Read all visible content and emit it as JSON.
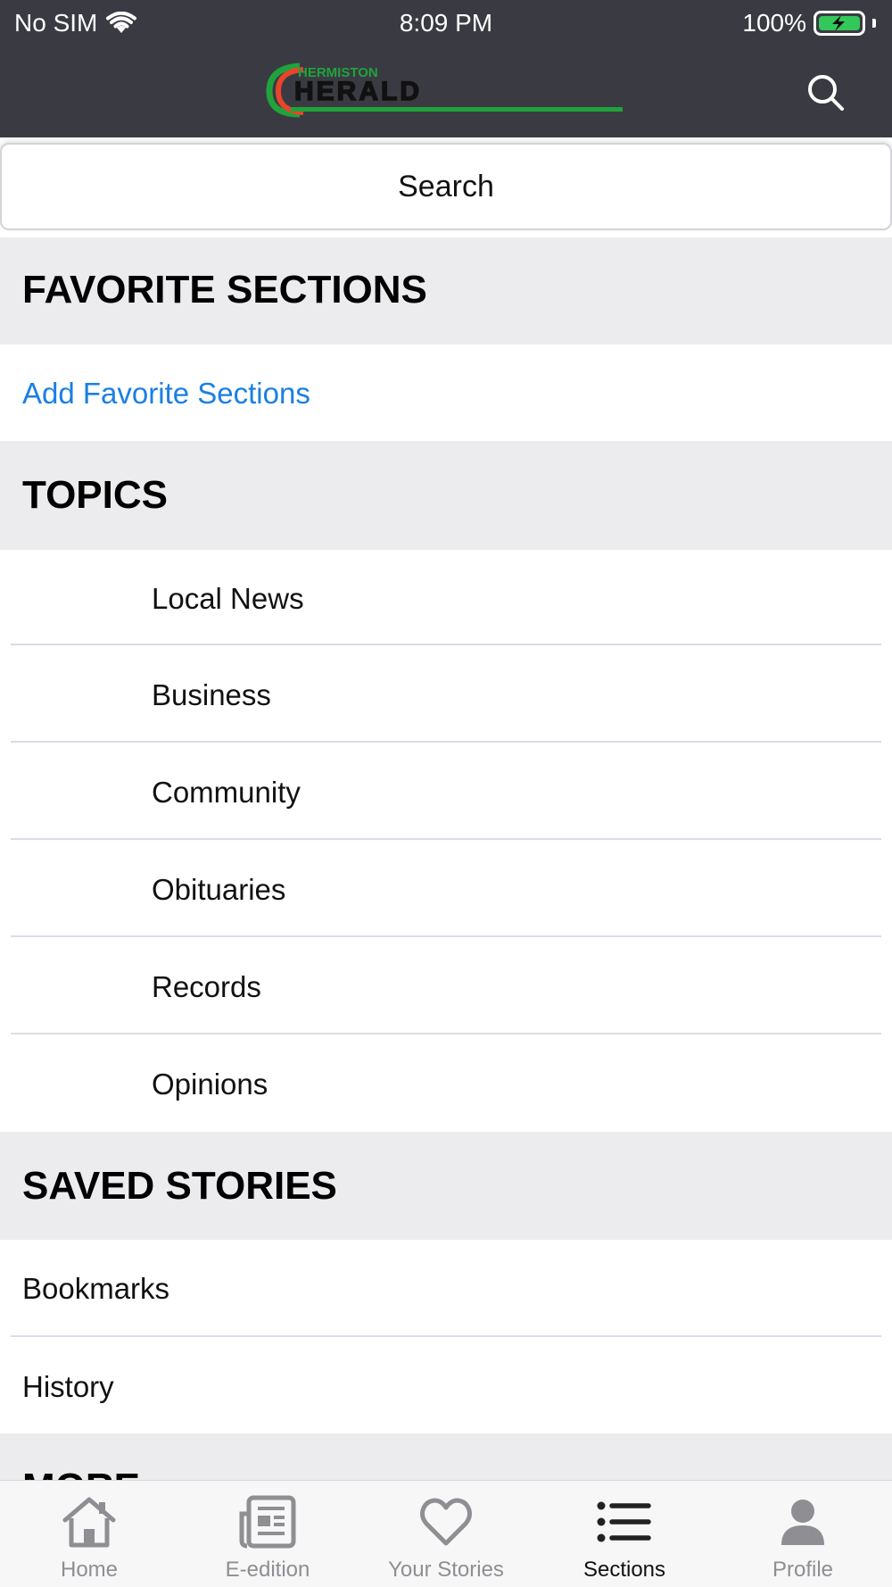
{
  "status_bar": {
    "carrier": "No SIM",
    "time": "8:09 PM",
    "battery": "100%"
  },
  "header": {
    "logo_top": "HERMISTON",
    "logo_main": "HERALD",
    "search_icon": "search-icon"
  },
  "search": {
    "label": "Search"
  },
  "favorite_sections": {
    "title": "FAVORITE SECTIONS",
    "add_label": "Add Favorite Sections"
  },
  "topics": {
    "title": "TOPICS",
    "items": [
      {
        "label": "Local News"
      },
      {
        "label": "Business"
      },
      {
        "label": "Community"
      },
      {
        "label": "Obituaries"
      },
      {
        "label": "Records"
      },
      {
        "label": "Opinions"
      }
    ]
  },
  "saved_stories": {
    "title": "SAVED STORIES",
    "items": [
      {
        "label": "Bookmarks"
      },
      {
        "label": "History"
      }
    ]
  },
  "more": {
    "title": "MORE"
  },
  "tabbar": {
    "tabs": [
      {
        "label": "Home",
        "icon": "home-icon"
      },
      {
        "label": "E-edition",
        "icon": "newspaper-icon"
      },
      {
        "label": "Your Stories",
        "icon": "heart-icon"
      },
      {
        "label": "Sections",
        "icon": "list-icon"
      },
      {
        "label": "Profile",
        "icon": "person-icon"
      }
    ],
    "active": "Sections"
  },
  "colors": {
    "header_bg": "#3a3b42",
    "section_bg": "#ececee",
    "link_blue": "#1a7fe4",
    "logo_green": "#1fa33a",
    "logo_red": "#e8452c",
    "tab_inactive": "#8e8e93"
  }
}
